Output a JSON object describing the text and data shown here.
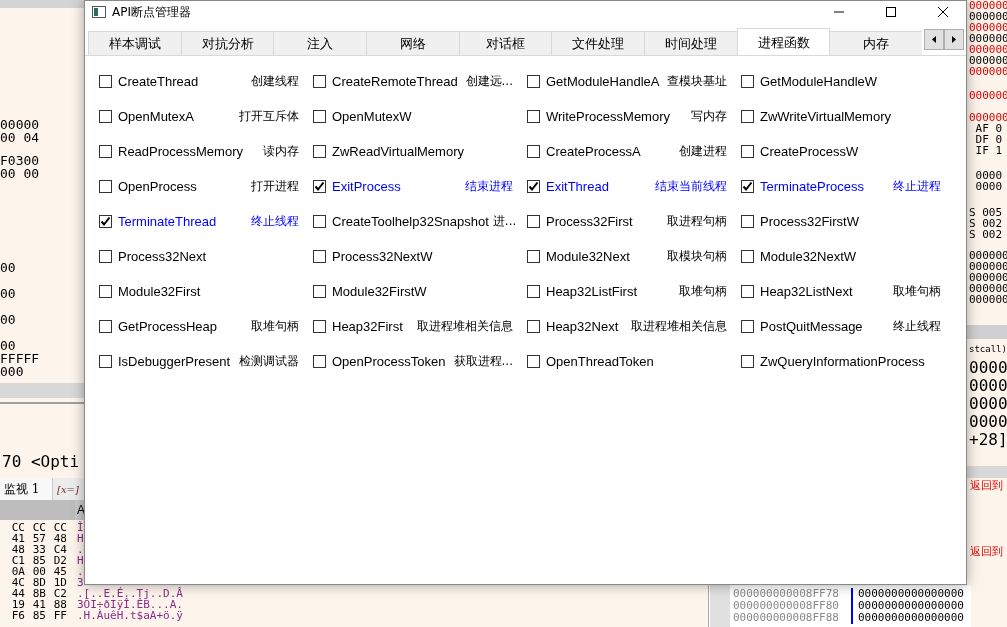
{
  "background": {
    "left_lines": [
      [
        "00000",
        "00 04"
      ],
      [
        "F0300",
        "00 00"
      ],
      [
        "00"
      ],
      [
        "00"
      ],
      [
        "00"
      ],
      [
        "00",
        "FFFFF",
        "000"
      ]
    ],
    "left_code": "70 <Opti",
    "left_tabs": [
      {
        "label": "监视 1",
        "selected": true
      },
      {
        "label": "[x=]",
        "selected": false
      }
    ],
    "left_ascii_header": "A",
    "hex_rows": [
      {
        "hex": [
          "CC",
          "CC",
          "CC"
        ],
        "ascii": "Ì"
      },
      {
        "hex": [
          "41",
          "57",
          "48"
        ],
        "ascii": "H"
      },
      {
        "hex": [
          "48",
          "33",
          "C4"
        ],
        "ascii": "."
      },
      {
        "hex": [
          "C1",
          "85",
          "D2"
        ],
        "ascii": "H"
      },
      {
        "hex": [
          "0A",
          "00",
          "45"
        ],
        "ascii": "."
      },
      {
        "hex": [
          "4C",
          "8D",
          "1D"
        ],
        "ascii": "3"
      },
      {
        "hex": [
          "44",
          "8B",
          "C2"
        ],
        "ascii": ".[..E.É..Tj..D.Â"
      },
      {
        "hex": [
          "19",
          "41",
          "88"
        ],
        "ascii": "3ÕI÷ðIÿÎ.ÊB...A."
      },
      {
        "hex": [
          "F6",
          "85",
          "FF"
        ],
        "ascii": ".H.ÀuêH.t$aA+ö.ÿ"
      }
    ],
    "right_groups": [
      [
        {
          "text": "000000",
          "color": "#e00000"
        },
        {
          "text": "000000",
          "color": "#000000"
        },
        {
          "text": "000000",
          "color": "#e00000"
        },
        {
          "text": "000000",
          "color": "#000000"
        },
        {
          "text": "000000",
          "color": "#e00000"
        },
        {
          "text": "000000",
          "color": "#000000"
        },
        {
          "text": "000000",
          "color": "#e00000"
        }
      ],
      [
        {
          "text": "000000",
          "color": "#e00000"
        }
      ],
      [
        {
          "text": "000000",
          "color": "#e00000"
        },
        {
          "text": " AF 0",
          "color": "#000000"
        },
        {
          "text": " DF 0",
          "color": "#000000"
        },
        {
          "text": " IF 1",
          "color": "#000000"
        }
      ],
      [
        {
          "text": " 0000",
          "color": "#000000"
        },
        {
          "text": " 0000",
          "color": "#000000"
        }
      ],
      [
        {
          "text": "S 005",
          "color": "#000000"
        },
        {
          "text": "S 002",
          "color": "#000000"
        },
        {
          "text": "S 002",
          "color": "#000000"
        }
      ],
      [
        {
          "text": "000000",
          "color": "#000000"
        },
        {
          "text": "000000",
          "color": "#000000"
        },
        {
          "text": "000000",
          "color": "#000000"
        },
        {
          "text": "000000",
          "color": "#000000"
        },
        {
          "text": "000000",
          "color": "#000000"
        }
      ]
    ],
    "right_call": "stcall)",
    "right_values": [
      "0000",
      "0000",
      "0000",
      "0000"
    ],
    "right_offset": "+28]",
    "right_returns": [
      "返回到",
      "返回到"
    ],
    "stack_rows": [
      {
        "address": "000000000008FF78",
        "value": "0000000000000000"
      },
      {
        "address": "000000000008FF80",
        "value": "0000000000000000"
      },
      {
        "address": "000000000008FF88",
        "value": "0000000000000000"
      }
    ]
  },
  "window": {
    "title": "API断点管理器"
  },
  "tabs": [
    {
      "label": "样本调试",
      "selected": false
    },
    {
      "label": "对抗分析",
      "selected": false
    },
    {
      "label": "注入",
      "selected": false
    },
    {
      "label": "网络",
      "selected": false
    },
    {
      "label": "对话框",
      "selected": false
    },
    {
      "label": "文件处理",
      "selected": false
    },
    {
      "label": "时间处理",
      "selected": false
    },
    {
      "label": "进程函数",
      "selected": true
    },
    {
      "label": "内存",
      "selected": false
    }
  ],
  "items": [
    {
      "name": "CreateThread",
      "note": "创建线程",
      "checked": false
    },
    {
      "name": "CreateRemoteThread",
      "note": "创建远...",
      "checked": false
    },
    {
      "name": "GetModuleHandleA",
      "note": "查模块基址",
      "checked": false
    },
    {
      "name": "GetModuleHandleW",
      "checked": false
    },
    {
      "name": "OpenMutexA",
      "note": "打开互斥体",
      "checked": false
    },
    {
      "name": "OpenMutexW",
      "checked": false
    },
    {
      "name": "WriteProcessMemory",
      "note": "写内存",
      "checked": false
    },
    {
      "name": "ZwWriteVirtualMemory",
      "checked": false
    },
    {
      "name": "ReadProcessMemory",
      "note": "读内存",
      "checked": false
    },
    {
      "name": "ZwReadVirtualMemory",
      "checked": false
    },
    {
      "name": "CreateProcessA",
      "note": "创建进程",
      "checked": false
    },
    {
      "name": "CreateProcessW",
      "checked": false
    },
    {
      "name": "OpenProcess",
      "note": "打开进程",
      "checked": false
    },
    {
      "name": "ExitProcess",
      "note": "结束进程",
      "checked": true
    },
    {
      "name": "ExitThread",
      "note": "结束当前线程",
      "checked": true
    },
    {
      "name": "TerminateProcess",
      "note": "终止进程",
      "checked": true
    },
    {
      "name": "TerminateThread",
      "note": "终止线程",
      "checked": true
    },
    {
      "name": "CreateToolhelp32Snapshot",
      "note": "进...",
      "checked": false
    },
    {
      "name": "Process32First",
      "note": "取进程句柄",
      "checked": false
    },
    {
      "name": "Process32FirstW",
      "checked": false
    },
    {
      "name": "Process32Next",
      "checked": false
    },
    {
      "name": "Process32NextW",
      "checked": false
    },
    {
      "name": "Module32Next",
      "note": "取模块句柄",
      "checked": false
    },
    {
      "name": "Module32NextW",
      "checked": false
    },
    {
      "name": "Module32First",
      "checked": false
    },
    {
      "name": "Module32FirstW",
      "checked": false
    },
    {
      "name": "Heap32ListFirst",
      "note": "取堆句柄",
      "checked": false
    },
    {
      "name": "Heap32ListNext",
      "note": "取堆句柄",
      "checked": false
    },
    {
      "name": "GetProcessHeap",
      "note": "取堆句柄",
      "checked": false
    },
    {
      "name": "Heap32First",
      "note": "取进程堆相关信息",
      "checked": false
    },
    {
      "name": "Heap32Next",
      "note": "取进程堆相关信息",
      "checked": false
    },
    {
      "name": "PostQuitMessage",
      "note": "终止线程",
      "checked": false
    },
    {
      "name": "IsDebuggerPresent",
      "note": "检测调试器",
      "checked": false
    },
    {
      "name": "OpenProcessToken",
      "note": "获取进程...",
      "checked": false
    },
    {
      "name": "OpenThreadToken",
      "checked": false
    },
    {
      "name": "ZwQueryInformationProcess",
      "checked": false
    }
  ]
}
